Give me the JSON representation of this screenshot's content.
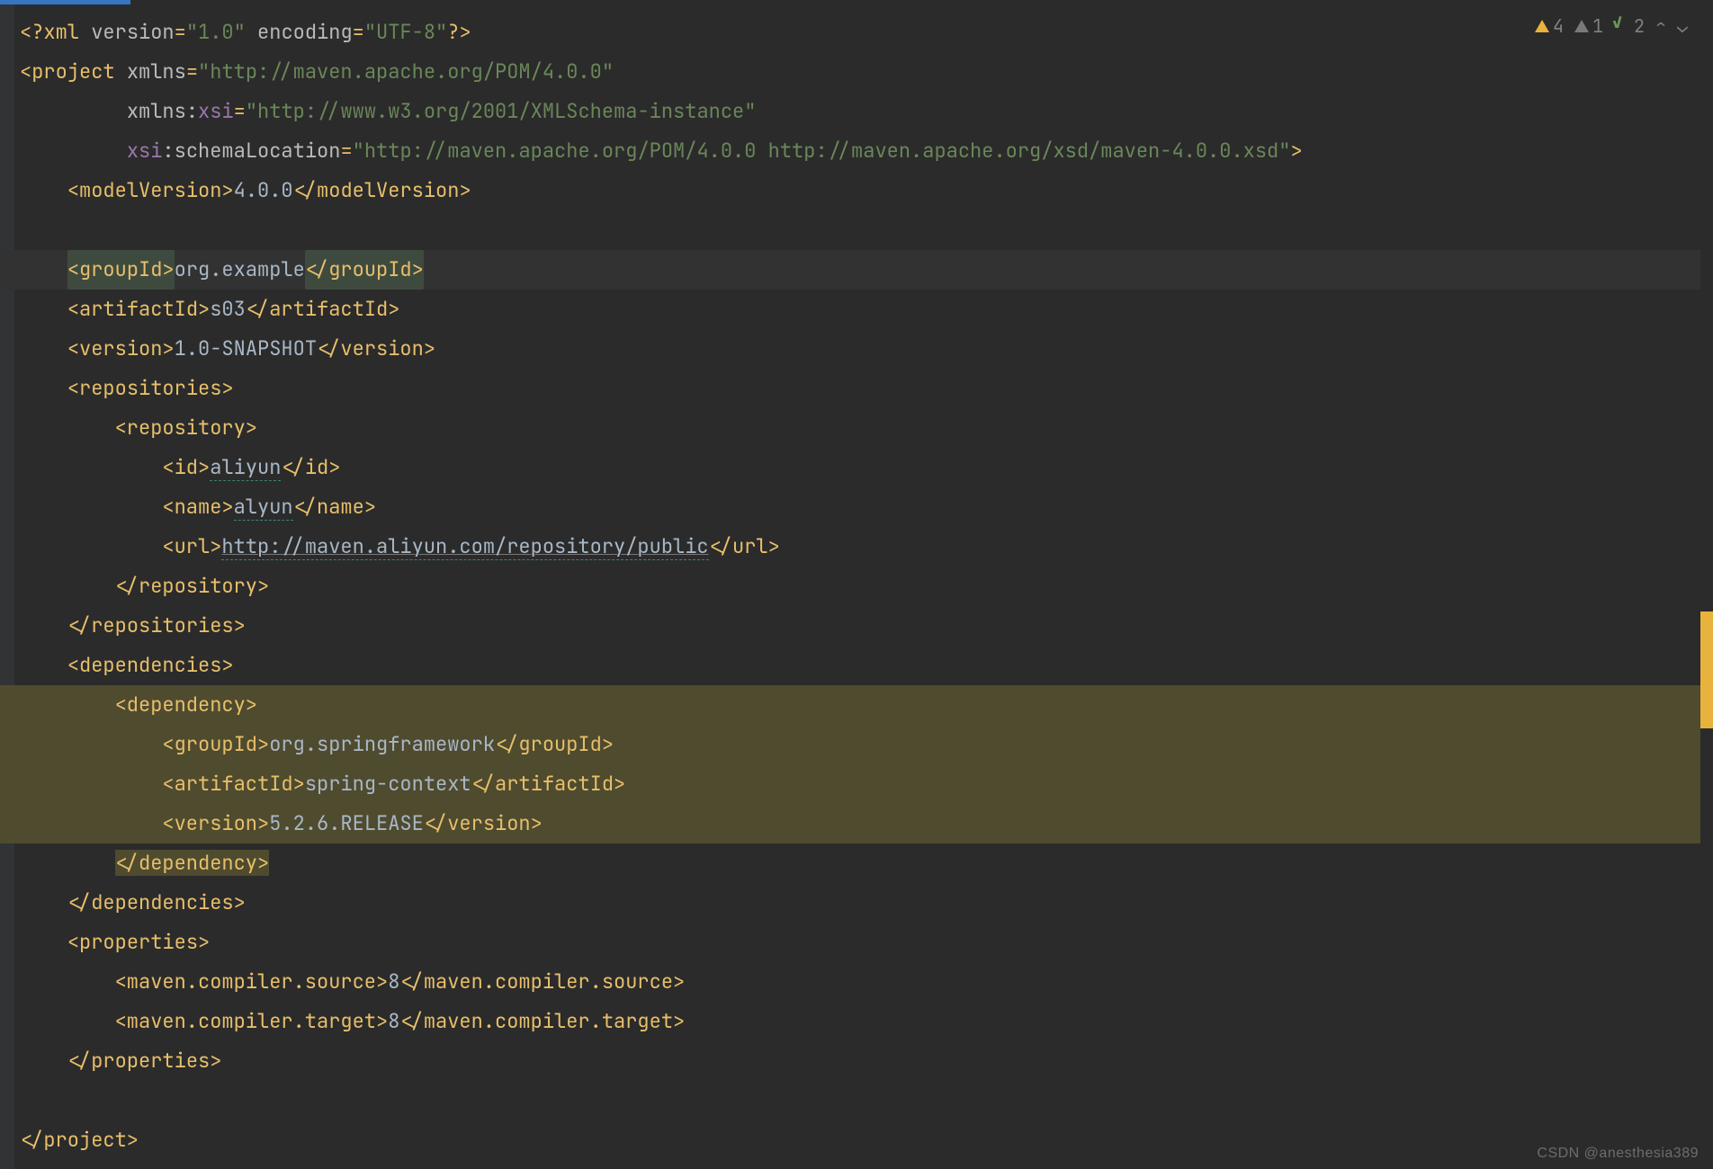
{
  "editor": {
    "watermark": "CSDN @anesthesia389",
    "inspections": {
      "warnings": 4,
      "weak_warnings": 1,
      "ok": 2
    },
    "xml_decl": {
      "open": "<?",
      "name": "xml",
      "attr1_name": "version",
      "attr1_val": "\"1.0\"",
      "attr2_name": "encoding",
      "attr2_val": "\"UTF-8\"",
      "close": "?>"
    },
    "project": {
      "open": "<",
      "name": "project",
      "xmlns_name": "xmlns",
      "xmlns_val": "\"http://maven.apache.org/POM/4.0.0\"",
      "xsi_pref": "xmlns",
      "xsi_ns": "xsi",
      "xsi_val": "\"http://www.w3.org/2001/XMLSchema-instance\"",
      "schemaloc_pref": "xsi",
      "schemaloc_name": "schemaLocation",
      "schemaloc_val": "\"http://maven.apache.org/POM/4.0.0 http://maven.apache.org/xsd/maven-4.0.0.xsd\"",
      "close_br": ">"
    },
    "modelVersion": {
      "open": "<modelVersion>",
      "text": "4.0.0",
      "close": "</modelVersion>"
    },
    "groupId": {
      "open": "<groupId>",
      "text": "org.example",
      "close": "</groupId>"
    },
    "artifactId": {
      "open": "<artifactId>",
      "text": "s03",
      "close": "</artifactId>"
    },
    "version": {
      "open": "<version>",
      "text": "1.0-SNAPSHOT",
      "close": "</version>"
    },
    "repositories": {
      "open": "<repositories>",
      "close": "</repositories>",
      "repository": {
        "open": "<repository>",
        "close": "</repository>",
        "id": {
          "open": "<id>",
          "text": "aliyun",
          "close": "</id>"
        },
        "name": {
          "open": "<name>",
          "text": "alyun",
          "close": "</name>"
        },
        "url": {
          "open": "<url>",
          "text": "http://maven.aliyun.com/repository/public",
          "close": "</url>"
        }
      }
    },
    "dependencies": {
      "open": "<dependencies>",
      "close": "</dependencies>",
      "dependency": {
        "open": "<dependency>",
        "close": "</dependency>",
        "groupId": {
          "open": "<groupId>",
          "text": "org.springframework",
          "close": "</groupId>"
        },
        "artifactId": {
          "open": "<artifactId>",
          "text": "spring-context",
          "close": "</artifactId>"
        },
        "version": {
          "open": "<version>",
          "text": "5.2.6.RELEASE",
          "close": "</version>"
        }
      }
    },
    "properties": {
      "open": "<properties>",
      "close": "</properties>",
      "source": {
        "open": "<maven.compiler.source>",
        "text": "8",
        "close": "</maven.compiler.source>"
      },
      "target": {
        "open": "<maven.compiler.target>",
        "text": "8",
        "close": "</maven.compiler.target>"
      }
    },
    "project_close": "</project>"
  }
}
